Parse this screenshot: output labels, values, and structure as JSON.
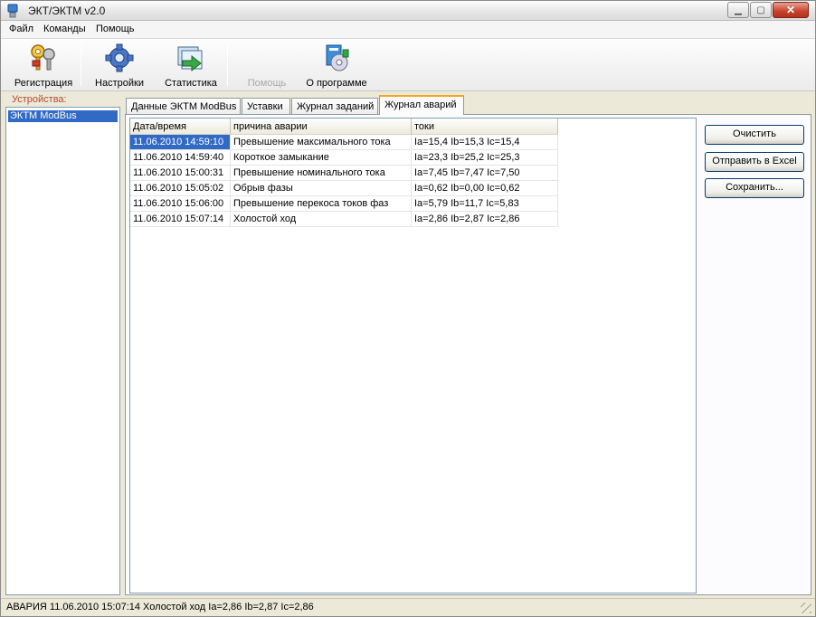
{
  "window": {
    "title": "ЭКТ/ЭКТМ v2.0"
  },
  "menu": [
    "Файл",
    "Команды",
    "Помощь"
  ],
  "toolbar": {
    "buttons": [
      {
        "label": "Регистрация",
        "icon": "keys-icon"
      },
      {
        "label": "Настройки",
        "icon": "gear-icon"
      },
      {
        "label": "Статистика",
        "icon": "statistics-icon"
      },
      {
        "label": "Помощь",
        "icon": "help-icon",
        "disabled": true
      },
      {
        "label": "О программе",
        "icon": "about-icon"
      }
    ]
  },
  "devices": {
    "label": "Устройства:",
    "items": [
      "ЭКТМ ModBus"
    ],
    "selected": "ЭКТМ ModBus"
  },
  "tabs": {
    "items": [
      "Данные ЭКТМ ModBus",
      "Уставки",
      "Журнал заданий",
      "Журнал аварий"
    ],
    "active": "Журнал аварий"
  },
  "log": {
    "columns": [
      "Дата/время",
      "причина аварии",
      "токи"
    ],
    "rows": [
      [
        "11.06.2010 14:59:10",
        "Превышение максимального тока",
        "Ia=15,4 Ib=15,3 Ic=15,4"
      ],
      [
        "11.06.2010 14:59:40",
        "Короткое замыкание",
        "Ia=23,3 Ib=25,2 Ic=25,3"
      ],
      [
        "11.06.2010 15:00:31",
        "Превышение номинального тока",
        "Ia=7,45 Ib=7,47 Ic=7,50"
      ],
      [
        "11.06.2010 15:05:02",
        "Обрыв фазы",
        "Ia=0,62 Ib=0,00 Ic=0,62"
      ],
      [
        "11.06.2010 15:06:00",
        "Превышение перекоса токов фаз",
        "Ia=5,79 Ib=11,7 Ic=5,83"
      ],
      [
        "11.06.2010 15:07:14",
        "Холостой ход",
        "Ia=2,86 Ib=2,87 Ic=2,86"
      ]
    ],
    "selected_row": 0
  },
  "actions": {
    "clear": "Очистить",
    "send_excel": "Отправить в Excel",
    "save": "Сохранить..."
  },
  "status": {
    "text": "АВАРИЯ 11.06.2010 15:07:14 Холостой ход Ia=2,86 Ib=2,87 Ic=2,86"
  }
}
